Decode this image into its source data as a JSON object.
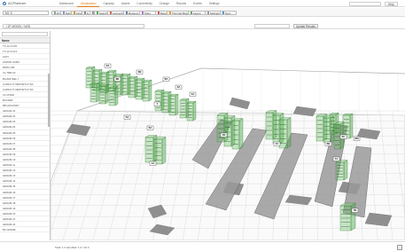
{
  "app": {
    "logo_text": "ACPlatform"
  },
  "nav": {
    "items": [
      "Dashboard",
      "Visualization",
      "Capacity",
      "Assets",
      "Connectivity",
      "Change",
      "Reports",
      "Events",
      "Settings"
    ],
    "active": 1,
    "user_label": "Help"
  },
  "toolbar": {
    "site": "MY S",
    "buttons": [
      "2D",
      "Name",
      "Assets",
      "Q",
      "Update",
      "Search",
      "Connectivity",
      "Measure",
      "Titles",
      "Reports",
      "Thermal Maps",
      "Layers",
      "Settings",
      "Sync"
    ]
  },
  "location": {
    "path": "/ 2F MODEL / NOD",
    "update_results_label": "Update Results"
  },
  "sidebar": {
    "header": "Name",
    "rows": [
      "TX-1A-5 F25",
      "TX-1A-5 F13",
      "HAT2",
      "ZAMOR HUMZ",
      "MDPU-MR",
      "XL-TMR-02",
      "BLUESTEEL 7",
      "CAPACITY REPORT2 P 8A",
      "CAPACITY REPORT2 P 8A",
      "CLUSTER",
      "BACKER",
      "BB GROUND7",
      "GENAM-01",
      "GENAM-02",
      "GENAM-03",
      "GENAM-04",
      "GENAM-05",
      "GENAM-06",
      "GENAM-07",
      "GENAM-08",
      "GENAM-09",
      "GENAM-10",
      "GENAM-11",
      "GENAM-12",
      "GENAM-13",
      "GENAM-14",
      "GENAM-15",
      "GENAM-16",
      "GENAM-17",
      "GENAM-18",
      "GENAM-19",
      "GENAM-20",
      "GENAM-21",
      "GENAM-22",
      "BX GRADE"
    ]
  },
  "racks": {
    "labels": [
      "2A",
      "2B",
      "3A",
      "4",
      "4A",
      "5A",
      "6A",
      "1A",
      "1B",
      "1C",
      "6B",
      "6C",
      "7A",
      "8M",
      "7B",
      "8B",
      "8A"
    ]
  },
  "status": {
    "left": "Total: 1 2 Items",
    "mid": "Sel: 1.2 / 10.4"
  },
  "colors": {
    "accent": "#e07b1a",
    "rack_green": "#5fbf5a",
    "floor_gray": "#8c8c8c"
  }
}
